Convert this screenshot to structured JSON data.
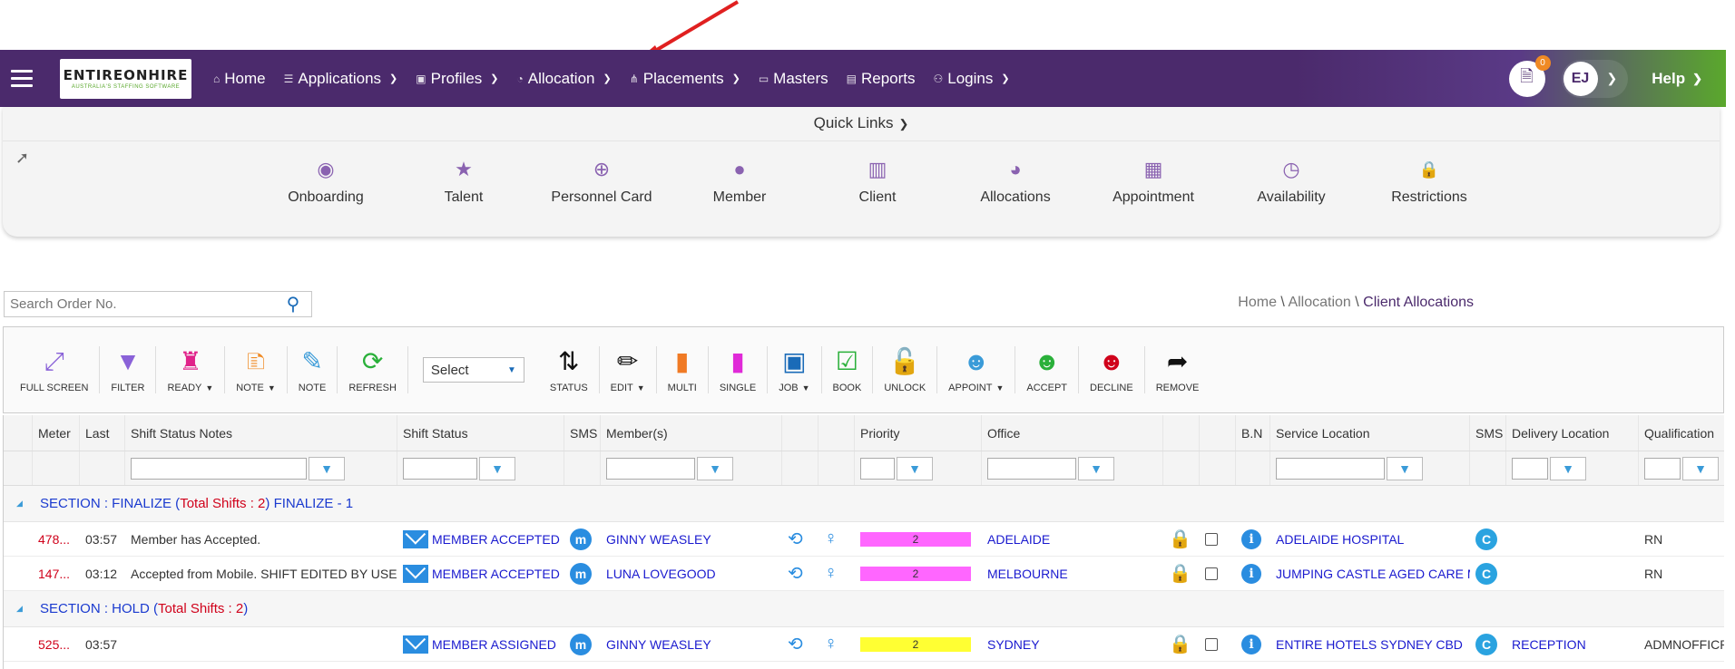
{
  "nav": {
    "logo_text": "ENTIREONHIRE",
    "logo_sub": "AUSTRALIA'S STAFFING SOFTWARE",
    "items": [
      {
        "label": "Home",
        "icon": "home-icon",
        "glyph": "⌂",
        "dropdown": false
      },
      {
        "label": "Applications",
        "icon": "list-icon",
        "glyph": "☰",
        "dropdown": true
      },
      {
        "label": "Profiles",
        "icon": "id-card-icon",
        "glyph": "▣",
        "dropdown": true
      },
      {
        "label": "Allocation",
        "icon": "pie-icon",
        "glyph": "◔",
        "dropdown": true
      },
      {
        "label": "Placements",
        "icon": "sitemap-icon",
        "glyph": "⋔",
        "dropdown": true
      },
      {
        "label": "Masters",
        "icon": "folder-icon",
        "glyph": "▭",
        "dropdown": false
      },
      {
        "label": "Reports",
        "icon": "report-icon",
        "glyph": "▤",
        "dropdown": false
      },
      {
        "label": "Logins",
        "icon": "user-icon",
        "glyph": "⚇",
        "dropdown": true
      }
    ],
    "doc_badge": "0",
    "user_initials": "EJ",
    "help_label": "Help"
  },
  "quick_links": {
    "title": "Quick Links",
    "items": [
      {
        "label": "Onboarding",
        "icon": "user-circle-icon",
        "glyph": "◉"
      },
      {
        "label": "Talent",
        "icon": "star-icon",
        "glyph": "★"
      },
      {
        "label": "Personnel Card",
        "icon": "search-plus-icon",
        "glyph": "⊕"
      },
      {
        "label": "Member",
        "icon": "person-icon",
        "glyph": "●"
      },
      {
        "label": "Client",
        "icon": "building-icon",
        "glyph": "▥"
      },
      {
        "label": "Allocations",
        "icon": "pie-chart-icon",
        "glyph": "◕"
      },
      {
        "label": "Appointment",
        "icon": "calendar-icon",
        "glyph": "▦"
      },
      {
        "label": "Availability",
        "icon": "clock-icon",
        "glyph": "◷"
      },
      {
        "label": "Restrictions",
        "icon": "lock-icon",
        "glyph": "🔒"
      }
    ]
  },
  "search": {
    "placeholder": "Search Order No."
  },
  "breadcrumb": {
    "home": "Home",
    "section": "Allocation",
    "current": "Client Allocations"
  },
  "toolbar": {
    "full_screen": "FULL SCREEN",
    "filter": "FILTER",
    "ready": "READY",
    "note_dd": "NOTE",
    "note": "NOTE",
    "refresh": "REFRESH",
    "select": "Select",
    "status": "STATUS",
    "edit": "EDIT",
    "multi": "MULTI",
    "single": "SINGLE",
    "job": "JOB",
    "book": "BOOK",
    "unlock": "UNLOCK",
    "appoint": "APPOINT",
    "accept": "ACCEPT",
    "decline": "DECLINE",
    "remove": "REMOVE"
  },
  "grid": {
    "headers": {
      "meter": "Meter",
      "last": "Last",
      "notes": "Shift Status Notes",
      "status": "Shift Status",
      "sms": "SMS",
      "members": "Member(s)",
      "priority": "Priority",
      "office": "Office",
      "bn": "B.N",
      "service": "Service Location",
      "sms2": "SMS",
      "delivery": "Delivery Location",
      "qual": "Qualification"
    },
    "sections": [
      {
        "label": "SECTION : FINALIZE (",
        "total": "Total Shifts : 2",
        "suffix": ") FINALIZE - 1"
      },
      {
        "label": "SECTION : HOLD (",
        "total": "Total Shifts : 2",
        "suffix": ")"
      }
    ],
    "rows": [
      {
        "meter": "478...",
        "last": "03:57",
        "notes": "Member has Accepted.",
        "status": "MEMBER ACCEPTED",
        "member": "GINNY WEASLEY",
        "priority": "2",
        "priority_color": "#ff66ff",
        "office": "ADELAIDE",
        "service": "ADELAIDE HOSPITAL",
        "delivery": "",
        "qual": "RN"
      },
      {
        "meter": "147...",
        "last": "03:12",
        "notes": "Accepted from Mobile. SHIFT EDITED BY USER EO",
        "status": "MEMBER ACCEPTED",
        "member": "LUNA LOVEGOOD",
        "priority": "2",
        "priority_color": "#ff66ff",
        "office": "MELBOURNE",
        "service": "JUMPING CASTLE AGED CARE M...",
        "delivery": "",
        "qual": "RN"
      },
      {
        "meter": "525...",
        "last": "03:57",
        "notes": "",
        "status": "MEMBER ASSIGNED",
        "member": "GINNY WEASLEY",
        "priority": "2",
        "priority_color": "#ffff33",
        "office": "SYDNEY",
        "service": "ENTIRE HOTELS SYDNEY CBD",
        "delivery": "RECEPTION",
        "qual": "ADMNOFFICR"
      }
    ],
    "sms_glyph": "m",
    "sms2_glyph": "C",
    "info_glyph": "i"
  }
}
